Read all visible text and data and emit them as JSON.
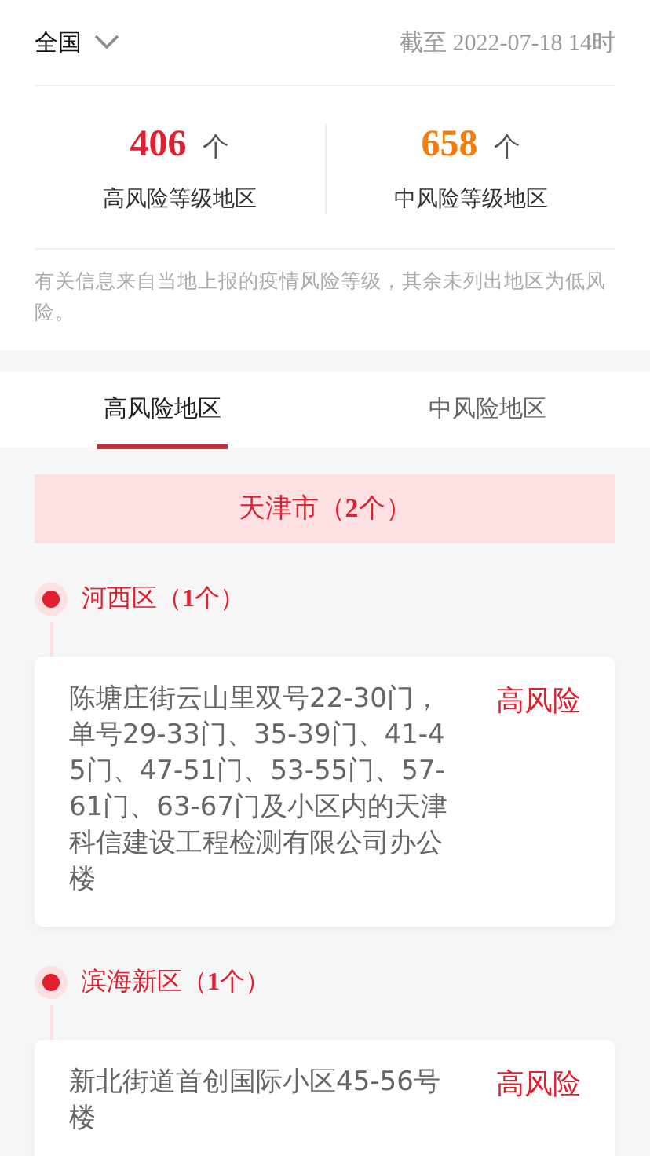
{
  "header": {
    "region": "全国",
    "updated": "截至 2022-07-18 14时"
  },
  "stats": [
    {
      "count": "406",
      "unit": "个",
      "label": "高风险等级地区",
      "color": "#e0202e"
    },
    {
      "count": "658",
      "unit": "个",
      "label": "中风险等级地区",
      "color": "#f57c0a"
    }
  ],
  "note": "有关信息来自当地上报的疫情风险等级，其余未列出地区为低风险。",
  "tabs": [
    {
      "label": "高风险地区",
      "selected": true
    },
    {
      "label": "中风险地区",
      "selected": false
    }
  ],
  "province": "天津市（**2**个）",
  "districts": [
    {
      "name": "河西区（**1**个）",
      "areas": [
        {
          "address": "陈塘庄街云山里双号22-30门，单号29-33门、35-39门、41-45门、47-51门、53-55门、57-61门、63-67门及小区内的天津科信建设工程检测有限公司办公楼",
          "risk": "高风险"
        }
      ]
    },
    {
      "name": "滨海新区（**1**个）",
      "areas": [
        {
          "address": "新北街道首创国际小区45-56号楼",
          "risk": "高风险"
        }
      ]
    }
  ]
}
